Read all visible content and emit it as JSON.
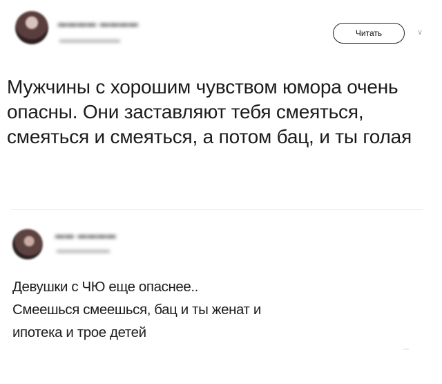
{
  "post": {
    "follow_label": "Читать",
    "chevron_glyph": "∨",
    "text": "Мужчины с хорошим чувством юмора очень опасны. Они заставляют тебя смеяться, смеяться и смеяться, а потом бац, и ты голая"
  },
  "reply": {
    "lines": [
      "Девушки с ЧЮ еще опаснее..",
      "Смеешься смеешься, бац и ты женат и",
      "ипотека и трое детей"
    ]
  }
}
